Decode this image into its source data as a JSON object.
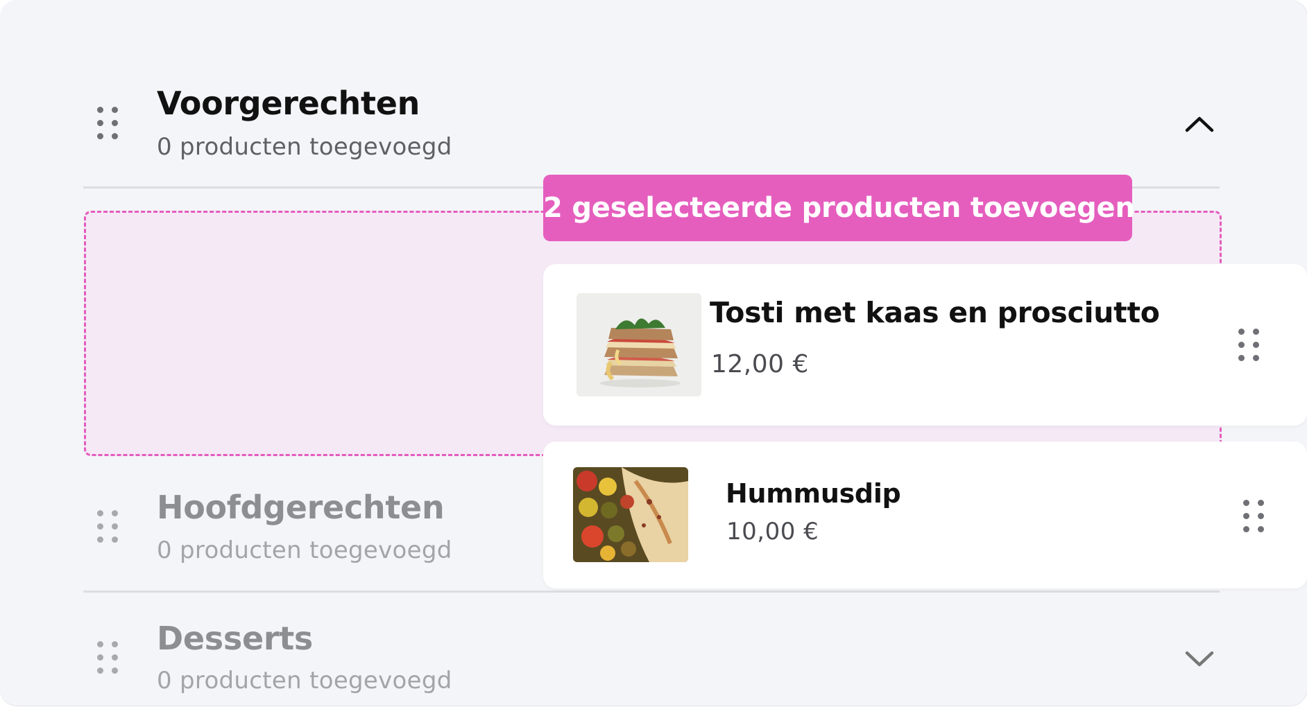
{
  "categories": [
    {
      "title": "Voorgerechten",
      "subtitle": "0 producten toegevoegd",
      "state": "expanded",
      "toggle_icon": "chevron-up-icon"
    },
    {
      "title": "Hoofdgerechten",
      "subtitle": "0 producten toegevoegd",
      "state": "faded"
    },
    {
      "title": "Desserts",
      "subtitle": "0 producten toegevoegd",
      "state": "collapsed",
      "toggle_icon": "chevron-down-icon"
    }
  ],
  "add_button": {
    "label": "2 geselecteerde producten toevoegen"
  },
  "dragged_products": [
    {
      "name": "Tosti met kaas en prosciutto",
      "price": "12,00 €",
      "image_icon": "sandwich-photo"
    },
    {
      "name": "Hummusdip",
      "price": "10,00 €",
      "image_icon": "hummus-photo"
    }
  ],
  "colors": {
    "accent": "#e55ebe",
    "drop_zone_bg": "#f5e9f6",
    "panel_bg": "#f4f5f8"
  }
}
